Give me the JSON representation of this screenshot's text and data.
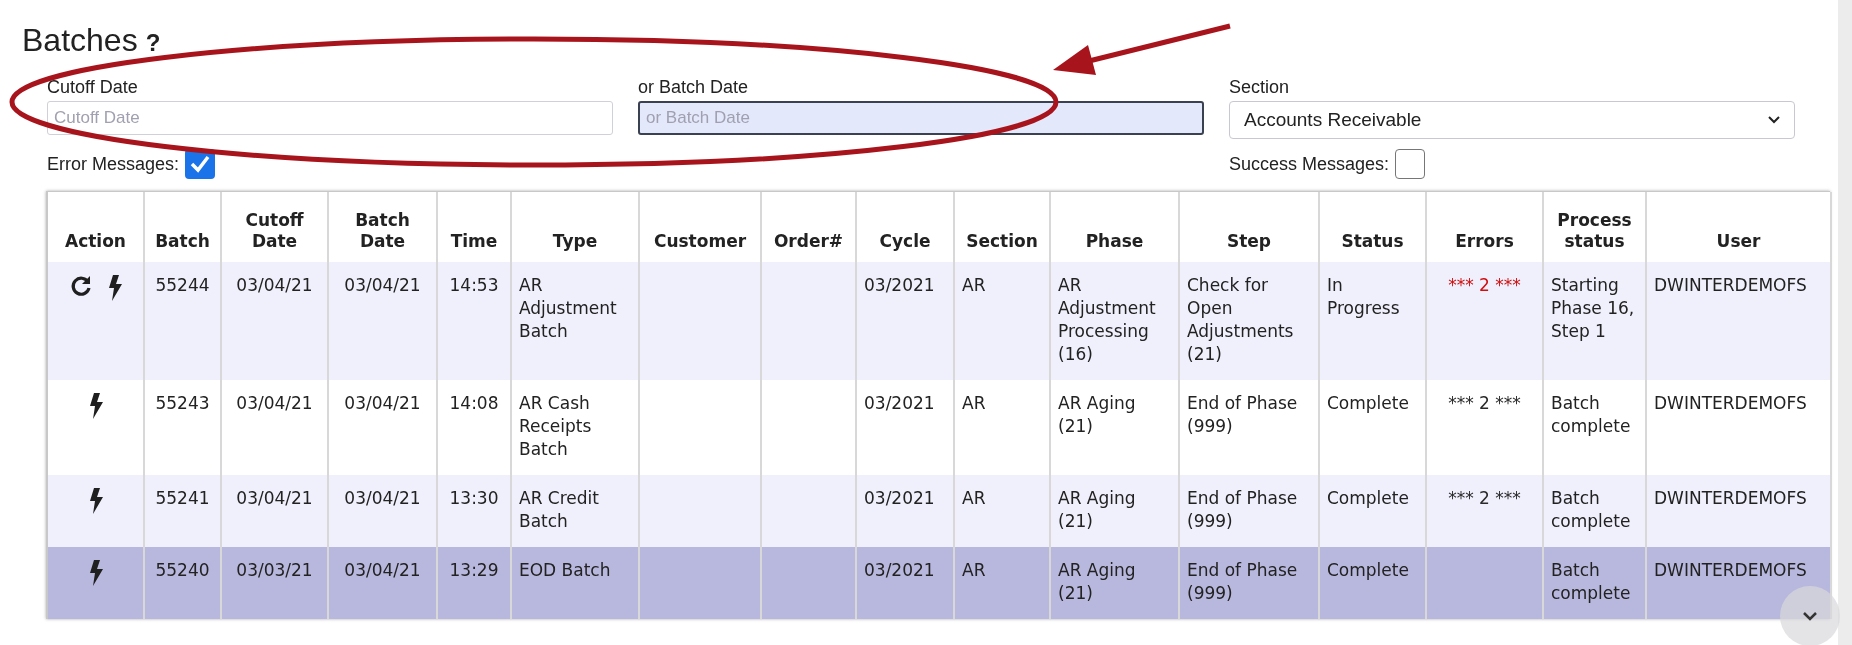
{
  "page": {
    "title": "Batches",
    "help": "?"
  },
  "filters": {
    "cutoff_date": {
      "label": "Cutoff Date",
      "placeholder": "Cutoff Date",
      "focused": false
    },
    "batch_date": {
      "label": "or Batch Date",
      "placeholder": "or Batch Date",
      "focused": true
    },
    "section": {
      "label": "Section",
      "value": "Accounts Receivable"
    },
    "error_messages": {
      "label": "Error Messages:",
      "checked": true
    },
    "success_messages": {
      "label": "Success Messages:",
      "checked": false
    }
  },
  "table": {
    "action_header": "Action",
    "columns": [
      "Batch",
      "Cutoff Date",
      "Batch Date",
      "Time",
      "Type",
      "Customer",
      "Order#",
      "Cycle",
      "Section",
      "Phase",
      "Step",
      "Status",
      "Errors",
      "Process status",
      "User"
    ],
    "rows": [
      {
        "selected": false,
        "actions": [
          {
            "kind": "refresh"
          },
          {
            "kind": "run"
          }
        ],
        "errors_alert": true,
        "cells": [
          "55244",
          "03/04/21",
          "03/04/21",
          "14:53",
          "AR Adjustment Batch",
          "",
          "",
          "03/2021",
          "AR",
          "AR Adjustment Processing (16)",
          "Check for Open Adjustments (21)",
          "In Progress",
          "*** 2 ***",
          "Starting Phase 16, Step 1",
          "DWINTERDEMOFS"
        ]
      },
      {
        "selected": false,
        "actions": [
          {
            "kind": "run"
          }
        ],
        "errors_alert": false,
        "cells": [
          "55243",
          "03/04/21",
          "03/04/21",
          "14:08",
          "AR Cash Receipts Batch",
          "",
          "",
          "03/2021",
          "AR",
          "AR Aging (21)",
          "End of Phase (999)",
          "Complete",
          "*** 2 ***",
          "Batch complete",
          "DWINTERDEMOFS"
        ]
      },
      {
        "selected": false,
        "actions": [
          {
            "kind": "run"
          }
        ],
        "errors_alert": false,
        "cells": [
          "55241",
          "03/04/21",
          "03/04/21",
          "13:30",
          "AR Credit Batch",
          "",
          "",
          "03/2021",
          "AR",
          "AR Aging (21)",
          "End of Phase (999)",
          "Complete",
          "*** 2 ***",
          "Batch complete",
          "DWINTERDEMOFS"
        ]
      },
      {
        "selected": true,
        "actions": [
          {
            "kind": "run"
          }
        ],
        "errors_alert": false,
        "cells": [
          "55240",
          "03/03/21",
          "03/04/21",
          "13:29",
          "EOD Batch",
          "",
          "",
          "03/2021",
          "AR",
          "AR Aging (21)",
          "End of Phase (999)",
          "Complete",
          "",
          "Batch complete",
          "DWINTERDEMOFS"
        ]
      }
    ]
  }
}
